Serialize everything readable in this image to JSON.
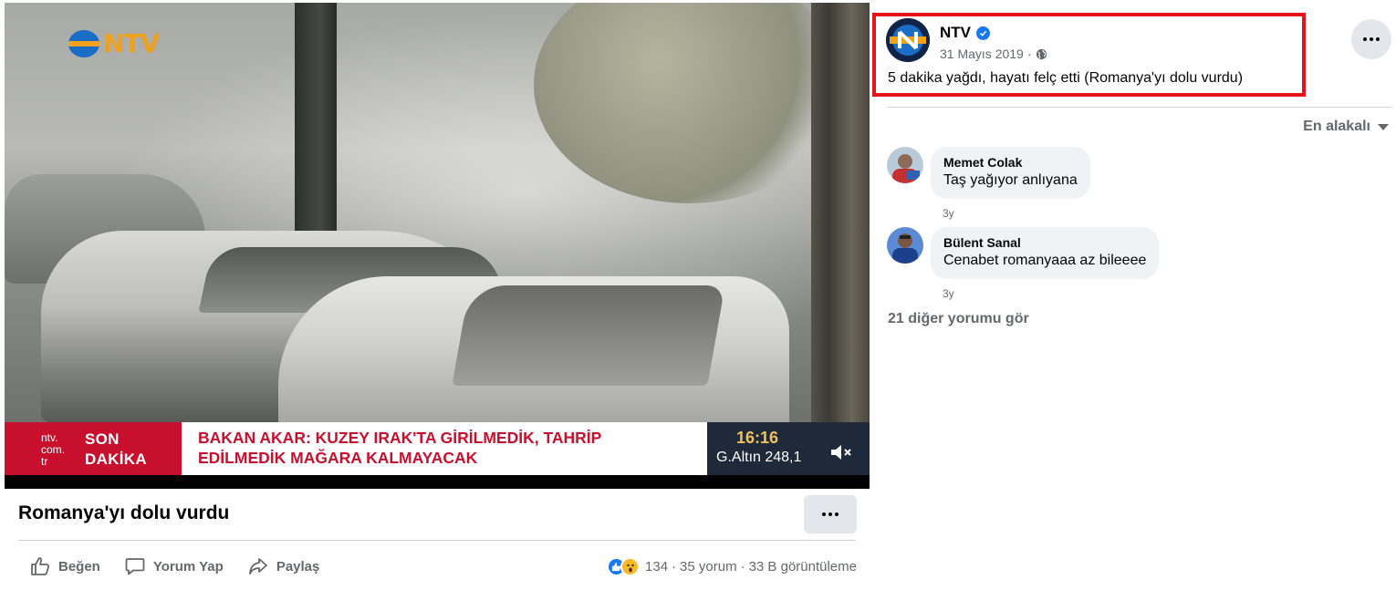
{
  "video": {
    "channel_logo": "NTV",
    "ticker": {
      "site_lines": [
        "ntv.",
        "com.",
        "tr"
      ],
      "breaking_line1": "SON",
      "breaking_line2": "DAKİKA",
      "headline_line1": "BAKAN AKAR: KUZEY IRAK'TA GİRİLMEDİK, TAHRİP",
      "headline_line2": "EDİLMEDİK MAĞARA KALMAYACAK",
      "time": "16:16",
      "market": "G.Altın 248,1"
    },
    "mute_icon": "volume-muted-icon"
  },
  "post": {
    "title": "Romanya'yı dolu vurdu",
    "actions": [
      {
        "label": "Beğen",
        "icon": "thumbs-up-icon"
      },
      {
        "label": "Yorum Yap",
        "icon": "comment-icon"
      },
      {
        "label": "Paylaş",
        "icon": "share-icon"
      }
    ],
    "stats": {
      "reactions": "134",
      "separator": "·",
      "comments": "35 yorum",
      "views": "33 B görüntüleme"
    }
  },
  "page": {
    "name": "NTV",
    "date": "31 Mayıs 2019",
    "date_separator": "·",
    "text": "5 dakika yağdı, hayatı felç etti (Romanya'yı dolu vurdu)"
  },
  "comments": {
    "sort_label": "En alakalı",
    "items": [
      {
        "author": "Memet Colak",
        "text": "Taş yağıyor anlıyana",
        "time": "3y"
      },
      {
        "author": "Bülent Sanal",
        "text": "Cenabet romanyaaa az bileeee",
        "time": "3y"
      }
    ],
    "more_label": "21 diğer yorumu gör"
  },
  "colors": {
    "highlight_border": "#e5141a",
    "facebook_blue": "#1877f2",
    "ticker_red": "#c8102e"
  }
}
